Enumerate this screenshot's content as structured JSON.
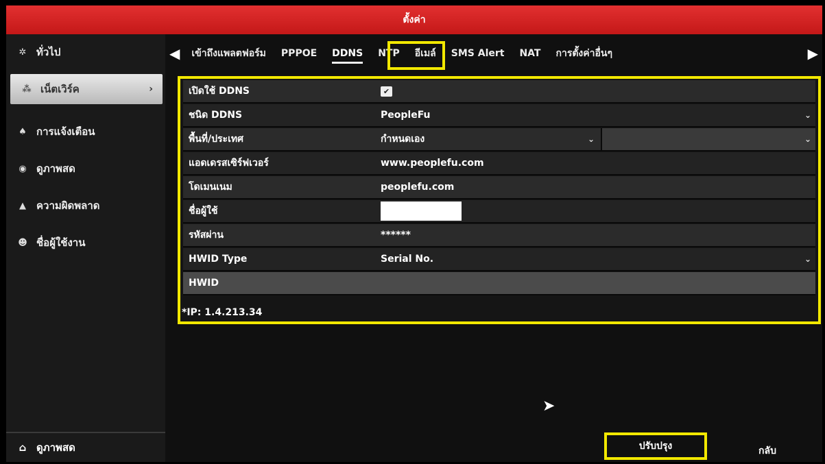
{
  "window": {
    "title": "ตั้งค่า"
  },
  "sidebar": {
    "items": [
      {
        "label": "ทั่วไป",
        "icon": "gear-icon"
      },
      {
        "label": "เน็ตเวิร์ค",
        "icon": "network-icon",
        "active": true
      },
      {
        "label": "การแจ้งเตือน",
        "icon": "alarm-icon"
      },
      {
        "label": "ดูภาพสด",
        "icon": "eye-icon"
      },
      {
        "label": "ความผิดพลาด",
        "icon": "warning-icon"
      },
      {
        "label": "ชื่อผู้ใช้งาน",
        "icon": "users-icon"
      }
    ],
    "bottom_label": "ดูภาพสด"
  },
  "tabs": [
    {
      "label": "เข้าถึงแพลตฟอร์ม"
    },
    {
      "label": "PPPOE"
    },
    {
      "label": "DDNS",
      "active": true
    },
    {
      "label": "NTP"
    },
    {
      "label": "อีเมล์"
    },
    {
      "label": "SMS Alert"
    },
    {
      "label": "NAT"
    },
    {
      "label": "การตั้งค่าอื่นๆ"
    }
  ],
  "form": {
    "enable_ddns": {
      "label": "เปิดใช้ DDNS",
      "checked": true
    },
    "ddns_type": {
      "label": "ชนิด DDNS",
      "value": "PeopleFu"
    },
    "region": {
      "label": "พื้นที่/ประเทศ",
      "value": "กำหนดเอง"
    },
    "server_address": {
      "label": "แอดเดรสเซิร์ฟเวอร์",
      "value": "www.peoplefu.com"
    },
    "domain": {
      "label": "โดเมนเนม",
      "value": "peoplefu.com"
    },
    "username": {
      "label": "ชื่อผู้ใช้",
      "value": ""
    },
    "password": {
      "label": "รหัสผ่าน",
      "value": "******"
    },
    "hwid_type": {
      "label": "HWID Type",
      "value": "Serial No."
    },
    "hwid": {
      "label": "HWID",
      "value": ""
    },
    "ip_note": "*IP: 1.4.213.34"
  },
  "buttons": {
    "apply": "ปรับปรุง",
    "back": "กลับ"
  },
  "colors": {
    "titlebar": "#d42020",
    "highlight": "#f2e800"
  }
}
